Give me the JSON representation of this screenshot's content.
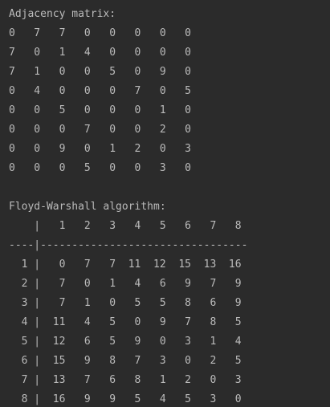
{
  "adjacency": {
    "header": "Adjacency matrix:",
    "rows": [
      "0   7   7   0   0   0   0   0",
      "7   0   1   4   0   0   0   0",
      "7   1   0   0   5   0   9   0",
      "0   4   0   0   0   7   0   5",
      "0   0   5   0   0   0   1   0",
      "0   0   0   7   0   0   2   0",
      "0   0   9   0   1   2   0   3",
      "0   0   0   5   0   0   3   0"
    ]
  },
  "floyd": {
    "header": "Floyd-Warshall algorithm:",
    "col_header": "    |   1   2   3   4   5   6   7   8",
    "separator": "----|---------------------------------",
    "rows": [
      "  1 |   0   7   7  11  12  15  13  16",
      "  2 |   7   0   1   4   6   9   7   9",
      "  3 |   7   1   0   5   5   8   6   9",
      "  4 |  11   4   5   0   9   7   8   5",
      "  5 |  12   6   5   9   0   3   1   4",
      "  6 |  15   9   8   7   3   0   2   5",
      "  7 |  13   7   6   8   1   2   0   3",
      "  8 |  16   9   9   5   4   5   3   0"
    ]
  }
}
